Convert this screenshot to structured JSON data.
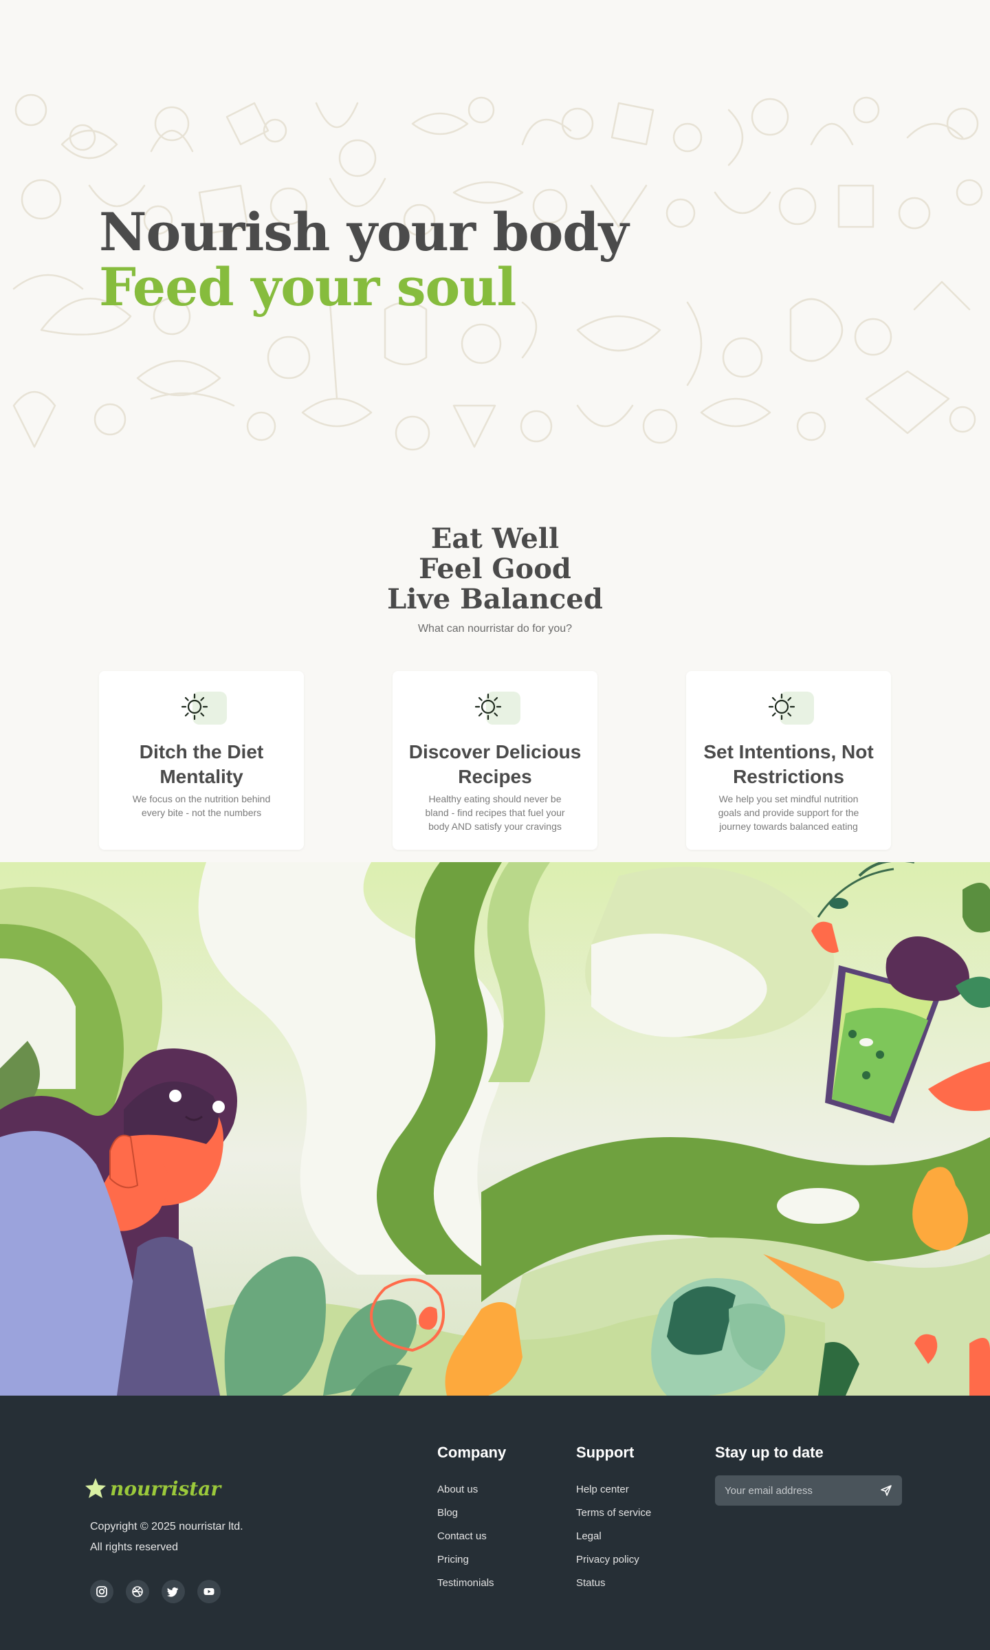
{
  "hero": {
    "title_line1": "Nourish your body",
    "title_line2": "Feed your soul"
  },
  "intro": {
    "heading": [
      "Eat Well",
      "Feel Good",
      "Live Balanced"
    ],
    "subheading": "What can nourristar do for you?"
  },
  "features": [
    {
      "icon": "sun-icon",
      "title": "Ditch the Diet Mentality",
      "description": "We focus on the nutrition behind every bite - not the numbers"
    },
    {
      "icon": "sun-icon",
      "title": "Discover Delicious Recipes",
      "description": "Healthy eating should never be bland - find recipes that fuel your body AND satisfy your cravings"
    },
    {
      "icon": "sun-icon",
      "title": "Set Intentions, Not Restrictions",
      "description": "We help you set mindful nutrition goals and provide support for the journey towards balanced eating"
    }
  ],
  "footer": {
    "logo": "nourristar",
    "copyright": "Copyright © 2025 nourristar ltd.",
    "rights": "All rights reserved",
    "socials": [
      "instagram-icon",
      "dribbble-icon",
      "twitter-icon",
      "youtube-icon"
    ],
    "company": {
      "heading": "Company",
      "links": [
        "About us",
        "Blog",
        "Contact us",
        "Pricing",
        "Testimonials"
      ]
    },
    "support": {
      "heading": "Support",
      "links": [
        "Help center",
        "Terms of service",
        "Legal",
        "Privacy policy",
        "Status"
      ]
    },
    "newsletter": {
      "heading": "Stay up to date",
      "placeholder": "Your email address"
    }
  },
  "colors": {
    "accent_green": "#86bc3d",
    "footer_bg": "#262f36",
    "page_bg": "#f9f8f5"
  }
}
